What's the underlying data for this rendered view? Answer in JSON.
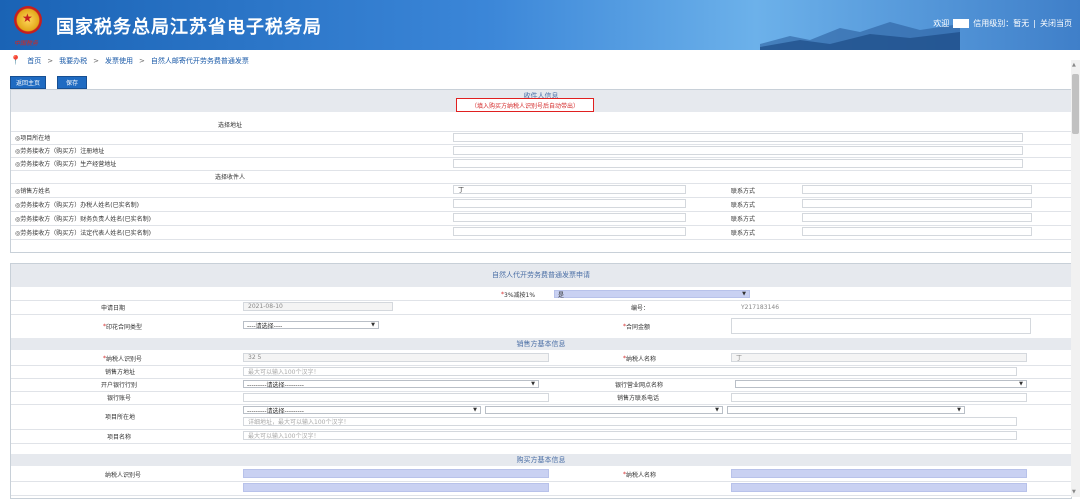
{
  "header": {
    "site_title": "国家税务总局江苏省电子税务局",
    "emblem_text": "中国税务",
    "welcome": "欢迎",
    "credit_level": "信用级别：暂无",
    "divider": "|",
    "close_page": "关闭当页"
  },
  "breadcrumb": {
    "items": [
      "首页",
      "我要办税",
      "发票使用",
      "自然人邮寄代开劳务费普通发票"
    ],
    "sep": ">"
  },
  "toolbar": {
    "back_label": "返回主页",
    "save_label": "保存"
  },
  "recipient": {
    "title": "收件人信息",
    "hint": "（填入购买方纳税人识别号后自动带出）",
    "select_address": "选择地址",
    "address_rows": [
      "◎项目所在地",
      "◎劳务接收方（购买方）注册地址",
      "◎劳务接收方（购买方）生产经营地址"
    ],
    "select_recipient": "选择收件人",
    "recipient_rows": [
      "◎销售方姓名",
      "◎劳务接收方（购买方）办税人姓名(已实名制)",
      "◎劳务接收方（购买方）财务负责人姓名(已实名制)",
      "◎劳务接收方（购买方）法定代表人姓名(已实名制)"
    ],
    "seller_name_value": "丁",
    "contact_label": "联系方式"
  },
  "application": {
    "title": "自然人代开劳务费普通发票申请",
    "tax_reduce_label": "3%减按1%",
    "tax_reduce_value": "是",
    "apply_date_label": "申请日期",
    "apply_date_value": "2021-08-10",
    "number_label": "编号：",
    "number_value": "Y217183146",
    "stamp_type_label": "印花合同类型",
    "stamp_type_value": "----请选择----",
    "contract_amount_label": "合同金额",
    "seller_section": "销售方基本信息",
    "seller_tin_label": "纳税人识别号",
    "seller_tin_value": "32                5",
    "seller_name_label": "纳税人名称",
    "seller_name_value": "丁",
    "seller_addr_label": "销售方地址",
    "addr_placeholder": "最大可以输入100个汉字！",
    "bank_label": "开户银行行别",
    "bank_value": "---------请选择---------",
    "bank_branch_label": "银行营业网点名称",
    "account_label": "银行账号",
    "seller_phone_label": "销售方联系电话",
    "project_loc_label": "项目所在地",
    "project_loc_value": "---------请选择---------",
    "detail_placeholder": "详细地址，最大可以输入100个汉字！",
    "project_name_label": "项目名称",
    "project_name_placeholder": "最大可以输入100个汉字！",
    "buyer_section": "购买方基本信息",
    "buyer_tin_label": "纳税人识别号",
    "buyer_name_label": "纳税人名称",
    "required_mark": "*"
  }
}
